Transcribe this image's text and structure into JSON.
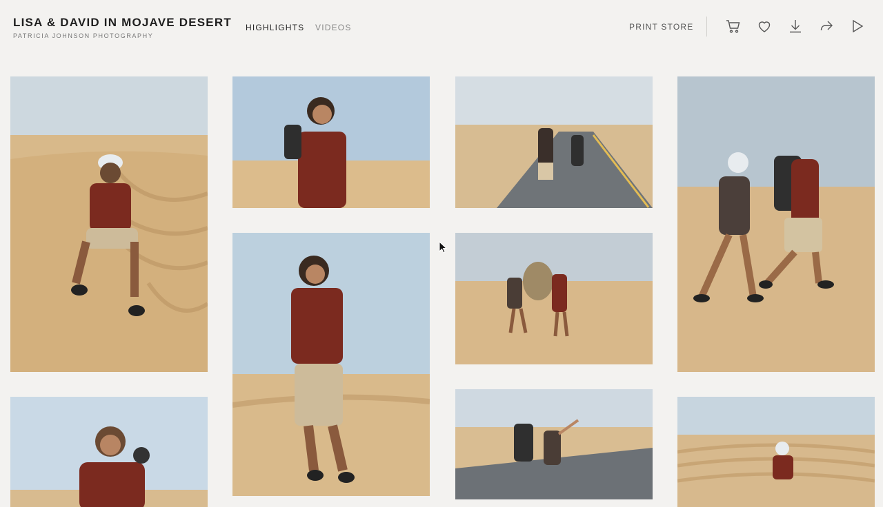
{
  "header": {
    "title": "LISA & DAVID IN MOJAVE DESERT",
    "subtitle": "PATRICIA JOHNSON PHOTOGRAPHY"
  },
  "nav": {
    "highlights": "HIGHLIGHTS",
    "videos": "VIDEOS"
  },
  "actions": {
    "print_store": "PRINT STORE",
    "icons": [
      "cart-icon",
      "heart-icon",
      "download-icon",
      "share-icon",
      "play-icon"
    ]
  },
  "colors": {
    "background": "#f3f2f0",
    "sky": "#b9cddd",
    "sand": "#dcbf93",
    "road": "#6f7478",
    "shirt": "#7b2a1f"
  },
  "gallery": {
    "photos": [
      "photo-man-sitting-dune",
      "photo-man-sunglasses-backpack",
      "photo-couple-walking-road",
      "photo-couple-hiking-sand",
      "photo-man-walking-dune",
      "photo-couple-sand-trees",
      "photo-man-smiling",
      "photo-couple-road-pointing",
      "photo-man-sitting-dunes-distance"
    ]
  }
}
